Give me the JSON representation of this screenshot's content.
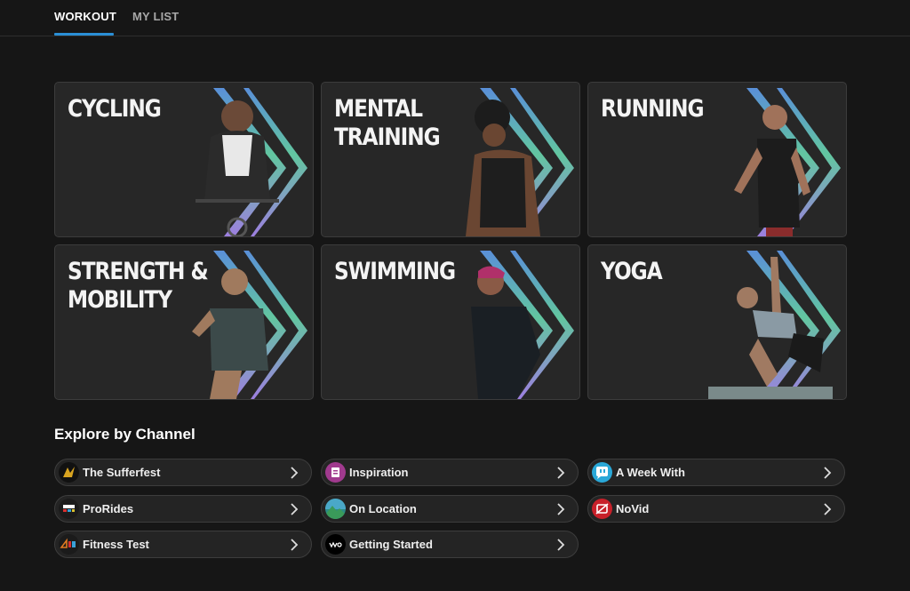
{
  "tabs": [
    {
      "label": "WORKOUT",
      "active": true
    },
    {
      "label": "MY LIST",
      "active": false
    }
  ],
  "workouts": [
    {
      "title": "CYCLING",
      "icon": "cyclist-photo"
    },
    {
      "title": "MENTAL\n  TRAINING",
      "icon": "meditation-photo"
    },
    {
      "title": "RUNNING",
      "icon": "runner-photo"
    },
    {
      "title": "STRENGTH &\n  MOBILITY",
      "icon": "strength-photo"
    },
    {
      "title": "SWIMMING",
      "icon": "swimmer-photo"
    },
    {
      "title": "YOGA",
      "icon": "yoga-photo"
    }
  ],
  "explore": {
    "title": "Explore by Channel",
    "channels": [
      {
        "label": "The Sufferfest",
        "icon": "sufferfest-logo-icon",
        "color": "#111111"
      },
      {
        "label": "Inspiration",
        "icon": "inspiration-icon",
        "color": "#a03a8e"
      },
      {
        "label": "A Week With",
        "icon": "a-week-with-icon",
        "color": "#2aa8d8"
      },
      {
        "label": "ProRides",
        "icon": "prorides-icon",
        "color": "#1b1b1b"
      },
      {
        "label": "On Location",
        "icon": "mountain-icon",
        "color": "#2c8c86"
      },
      {
        "label": "NoVid",
        "icon": "novid-icon",
        "color": "#c8202a"
      },
      {
        "label": "Fitness Test",
        "icon": "4dp-icon",
        "color": "#1b1b1b"
      },
      {
        "label": "Getting Started",
        "icon": "wahoo-icon",
        "color": "#000000"
      }
    ]
  },
  "colors": {
    "accent": "#2a8fd6",
    "background": "#161616",
    "card": "#272727"
  }
}
